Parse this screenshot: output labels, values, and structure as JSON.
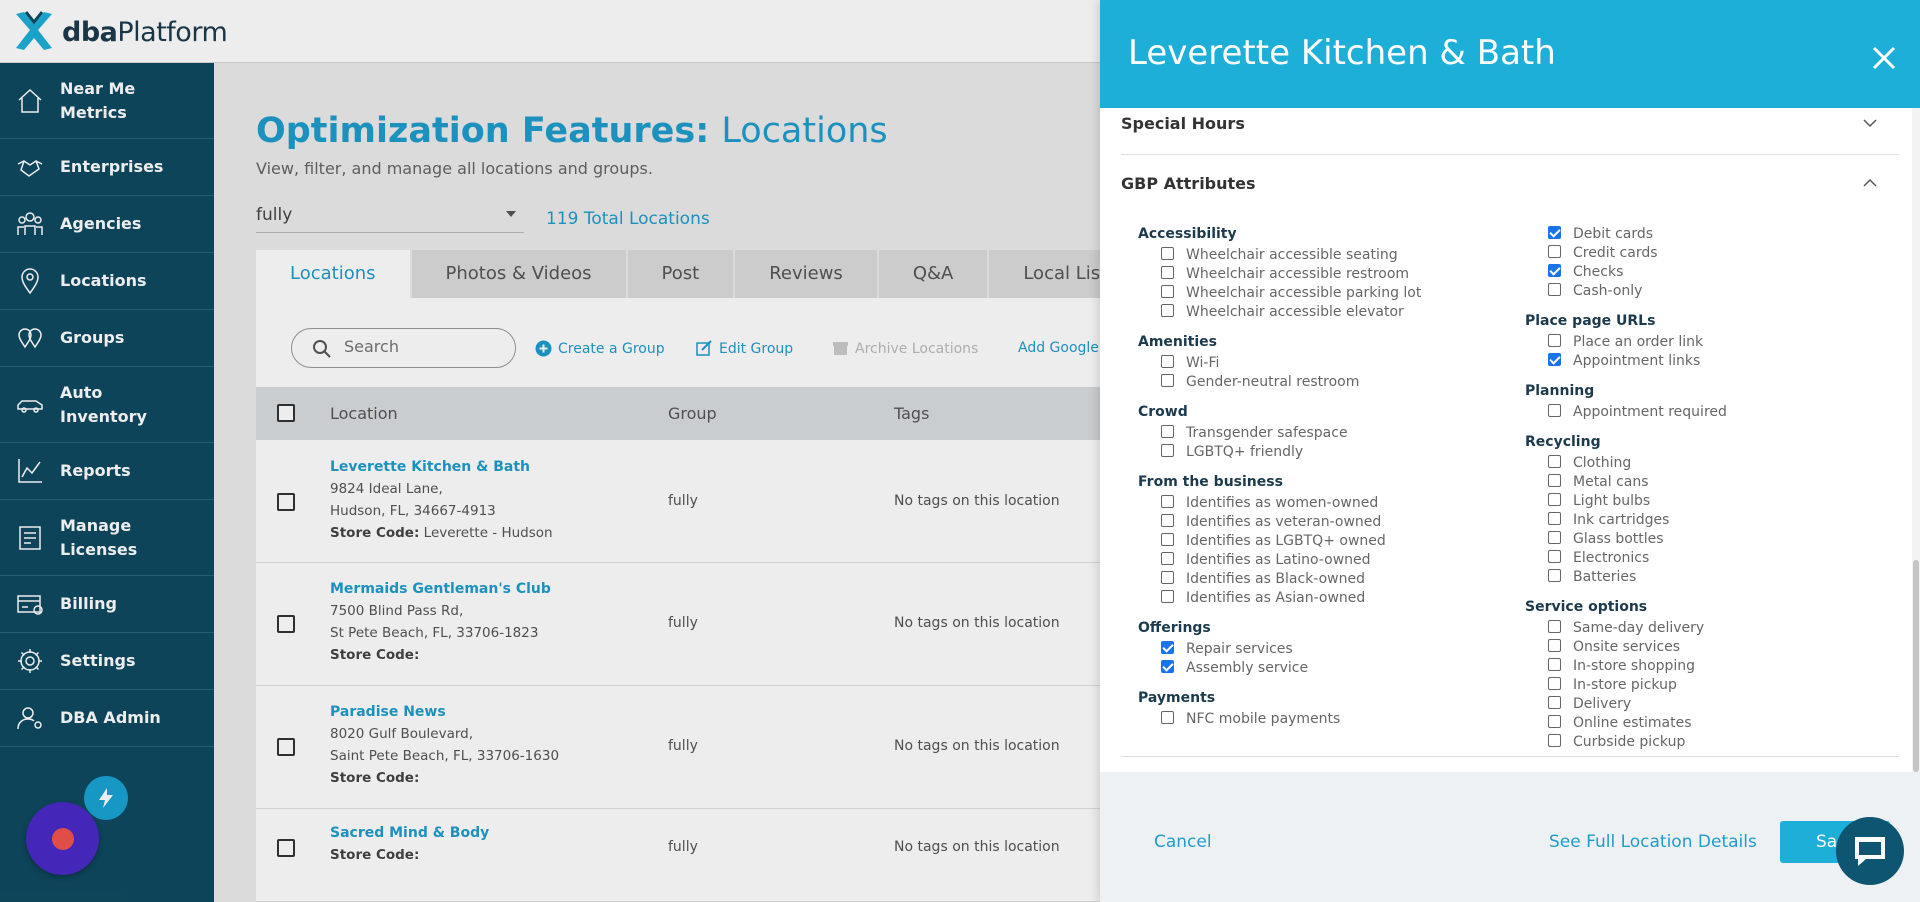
{
  "brand": {
    "name_bold": "dba",
    "name_rest": "Platform"
  },
  "sidebar": {
    "items": [
      {
        "label": "Near Me\nMetrics",
        "icon": "home-icon"
      },
      {
        "label": "Enterprises",
        "icon": "handshake-icon"
      },
      {
        "label": "Agencies",
        "icon": "people-icon"
      },
      {
        "label": "Locations",
        "icon": "map-pin-icon"
      },
      {
        "label": "Groups",
        "icon": "group-pins-icon"
      },
      {
        "label": "Auto\nInventory",
        "icon": "car-icon"
      },
      {
        "label": "Reports",
        "icon": "line-chart-icon"
      },
      {
        "label": "Manage\nLicenses",
        "icon": "license-icon"
      },
      {
        "label": "Billing",
        "icon": "billing-icon"
      },
      {
        "label": "Settings",
        "icon": "gear-icon"
      },
      {
        "label": "DBA Admin",
        "icon": "admin-user-icon"
      }
    ]
  },
  "page": {
    "title_bold": "Optimization Features:",
    "title_light": "Locations",
    "subtitle": "View, filter, and manage all locations and groups.",
    "filter_value": "fully",
    "total_locations": "119 Total Locations"
  },
  "tabs": [
    "Locations",
    "Photos & Videos",
    "Post",
    "Reviews",
    "Q&A",
    "Local Listin"
  ],
  "toolbar": {
    "search_placeholder": "Search",
    "create_group": "Create a Group",
    "edit_group": "Edit Group",
    "archive": "Archive Locations",
    "add_google": "Add Google"
  },
  "table": {
    "headers": {
      "location": "Location",
      "group": "Group",
      "tags": "Tags"
    },
    "rows": [
      {
        "name": "Leverette Kitchen & Bath",
        "addr1": "9824 Ideal Lane,",
        "addr2": "Hudson, FL, 34667-4913",
        "store_label": "Store Code:",
        "store_code": "Leverette - Hudson",
        "group": "fully",
        "tags": "No tags on this location"
      },
      {
        "name": "Mermaids Gentleman's Club",
        "addr1": "7500 Blind Pass Rd,",
        "addr2": "St Pete Beach, FL, 33706-1823",
        "store_label": "Store Code:",
        "store_code": "",
        "group": "fully",
        "tags": "No tags on this location"
      },
      {
        "name": "Paradise News",
        "addr1": "8020 Gulf Boulevard,",
        "addr2": "Saint Pete Beach, FL, 33706-1630",
        "store_label": "Store Code:",
        "store_code": "",
        "group": "fully",
        "tags": "No tags on this location"
      },
      {
        "name": "Sacred Mind & Body",
        "addr1": "",
        "addr2": "",
        "store_label": "Store Code:",
        "store_code": "",
        "group": "fully",
        "tags": "No tags on this location"
      }
    ]
  },
  "drawer": {
    "title": "Leverette Kitchen & Bath",
    "special_hours": "Special Hours",
    "gbp_attributes": "GBP Attributes",
    "left_col": [
      {
        "category": "Accessibility",
        "items": [
          {
            "label": "Wheelchair accessible seating",
            "checked": false
          },
          {
            "label": "Wheelchair accessible restroom",
            "checked": false
          },
          {
            "label": "Wheelchair accessible parking lot",
            "checked": false
          },
          {
            "label": "Wheelchair accessible elevator",
            "checked": false
          }
        ]
      },
      {
        "category": "Amenities",
        "items": [
          {
            "label": "Wi-Fi",
            "checked": false
          },
          {
            "label": "Gender-neutral restroom",
            "checked": false
          }
        ]
      },
      {
        "category": "Crowd",
        "items": [
          {
            "label": "Transgender safespace",
            "checked": false
          },
          {
            "label": "LGBTQ+ friendly",
            "checked": false
          }
        ]
      },
      {
        "category": "From the business",
        "items": [
          {
            "label": "Identifies as women-owned",
            "checked": false
          },
          {
            "label": "Identifies as veteran-owned",
            "checked": false
          },
          {
            "label": "Identifies as LGBTQ+ owned",
            "checked": false
          },
          {
            "label": "Identifies as Latino-owned",
            "checked": false
          },
          {
            "label": "Identifies as Black-owned",
            "checked": false
          },
          {
            "label": "Identifies as Asian-owned",
            "checked": false
          }
        ]
      },
      {
        "category": "Offerings",
        "items": [
          {
            "label": "Repair services",
            "checked": true
          },
          {
            "label": "Assembly service",
            "checked": true
          }
        ]
      },
      {
        "category": "Payments",
        "items": [
          {
            "label": "NFC mobile payments",
            "checked": false
          }
        ]
      }
    ],
    "right_col": [
      {
        "category": "",
        "items": [
          {
            "label": "Debit cards",
            "checked": true
          },
          {
            "label": "Credit cards",
            "checked": false
          },
          {
            "label": "Checks",
            "checked": true
          },
          {
            "label": "Cash-only",
            "checked": false
          }
        ]
      },
      {
        "category": "Place page URLs",
        "items": [
          {
            "label": "Place an order link",
            "checked": false
          },
          {
            "label": "Appointment links",
            "checked": true
          }
        ]
      },
      {
        "category": "Planning",
        "items": [
          {
            "label": "Appointment required",
            "checked": false
          }
        ]
      },
      {
        "category": "Recycling",
        "items": [
          {
            "label": "Clothing",
            "checked": false
          },
          {
            "label": "Metal cans",
            "checked": false
          },
          {
            "label": "Light bulbs",
            "checked": false
          },
          {
            "label": "Ink cartridges",
            "checked": false
          },
          {
            "label": "Glass bottles",
            "checked": false
          },
          {
            "label": "Electronics",
            "checked": false
          },
          {
            "label": "Batteries",
            "checked": false
          }
        ]
      },
      {
        "category": "Service options",
        "items": [
          {
            "label": "Same-day delivery",
            "checked": false
          },
          {
            "label": "Onsite services",
            "checked": false
          },
          {
            "label": "In-store shopping",
            "checked": false
          },
          {
            "label": "In-store pickup",
            "checked": false
          },
          {
            "label": "Delivery",
            "checked": false
          },
          {
            "label": "Online estimates",
            "checked": false
          },
          {
            "label": "Curbside pickup",
            "checked": false
          }
        ]
      }
    ],
    "footer": {
      "cancel": "Cancel",
      "full_details": "See Full Location Details",
      "save": "Sa"
    }
  },
  "colors": {
    "accent": "#1eafd8",
    "sidebar": "#0f4a60",
    "link": "#1f9ccc"
  }
}
